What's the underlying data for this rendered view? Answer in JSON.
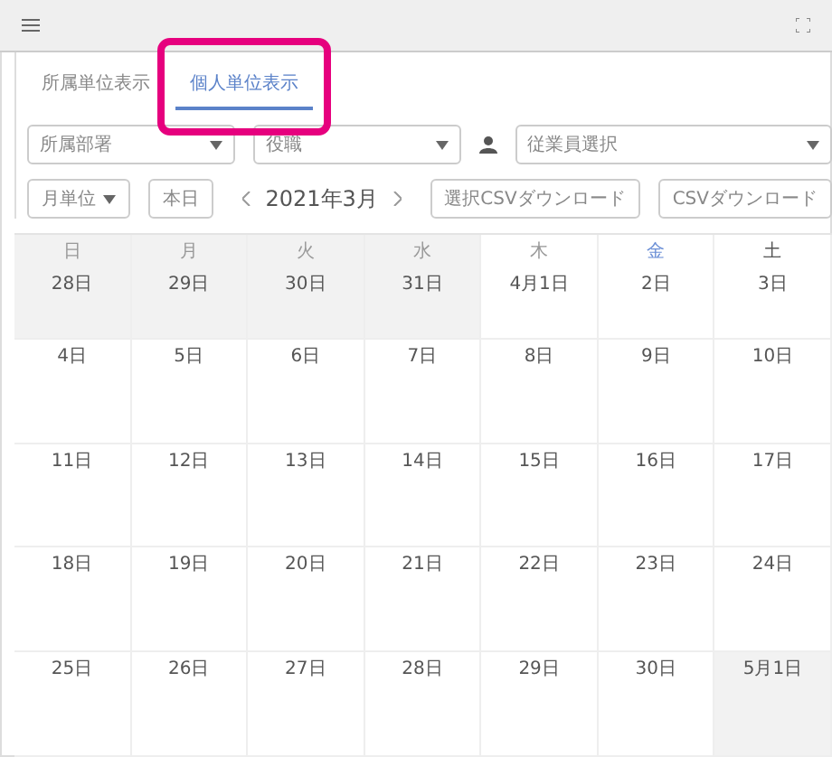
{
  "tabs": [
    {
      "label": "所属単位表示",
      "selected": false,
      "highlighted": false
    },
    {
      "label": "個人単位表示",
      "selected": true,
      "highlighted": true
    }
  ],
  "filters": [
    {
      "kind": "select",
      "placeholder": "所属部署"
    },
    {
      "kind": "select",
      "placeholder": "役職"
    },
    {
      "kind": "employee",
      "placeholder": "従業員選択"
    }
  ],
  "toolbar": {
    "view_button": "月単位",
    "today_button": "本日",
    "month": "2021年3月",
    "buttons": [
      "選択CSVダウンロード",
      "CSVダウンロード"
    ]
  },
  "weekdays": [
    {
      "label": "日",
      "color": "#999999"
    },
    {
      "label": "月",
      "color": "#999999"
    },
    {
      "label": "火",
      "color": "#999999"
    },
    {
      "label": "水",
      "color": "#999999"
    },
    {
      "label": "木",
      "color": "#999999"
    },
    {
      "label": "金",
      "color": "#6b8fd6"
    },
    {
      "label": "土",
      "color": "#555555"
    }
  ],
  "weeks": [
    [
      {
        "date": "28日",
        "outside": true
      },
      {
        "date": "29日",
        "outside": true
      },
      {
        "date": "30日",
        "outside": true
      },
      {
        "date": "31日",
        "outside": true
      },
      {
        "date": "4月1日",
        "outside": false
      },
      {
        "date": "2日",
        "outside": false
      },
      {
        "date": "3日",
        "outside": false
      }
    ],
    [
      {
        "date": "4日",
        "outside": false
      },
      {
        "date": "5日",
        "outside": false
      },
      {
        "date": "6日",
        "outside": false
      },
      {
        "date": "7日",
        "outside": false
      },
      {
        "date": "8日",
        "outside": false
      },
      {
        "date": "9日",
        "outside": false
      },
      {
        "date": "10日",
        "outside": false
      }
    ],
    [
      {
        "date": "11日",
        "outside": false
      },
      {
        "date": "12日",
        "outside": false
      },
      {
        "date": "13日",
        "outside": false
      },
      {
        "date": "14日",
        "outside": false
      },
      {
        "date": "15日",
        "outside": false
      },
      {
        "date": "16日",
        "outside": false
      },
      {
        "date": "17日",
        "outside": false
      }
    ],
    [
      {
        "date": "18日",
        "outside": false
      },
      {
        "date": "19日",
        "outside": false
      },
      {
        "date": "20日",
        "outside": false
      },
      {
        "date": "21日",
        "outside": false
      },
      {
        "date": "22日",
        "outside": false
      },
      {
        "date": "23日",
        "outside": false
      },
      {
        "date": "24日",
        "outside": false
      }
    ],
    [
      {
        "date": "25日",
        "outside": false
      },
      {
        "date": "26日",
        "outside": false
      },
      {
        "date": "27日",
        "outside": false
      },
      {
        "date": "28日",
        "outside": false
      },
      {
        "date": "29日",
        "outside": false
      },
      {
        "date": "30日",
        "outside": false
      },
      {
        "date": "5月1日",
        "outside": true
      }
    ]
  ]
}
